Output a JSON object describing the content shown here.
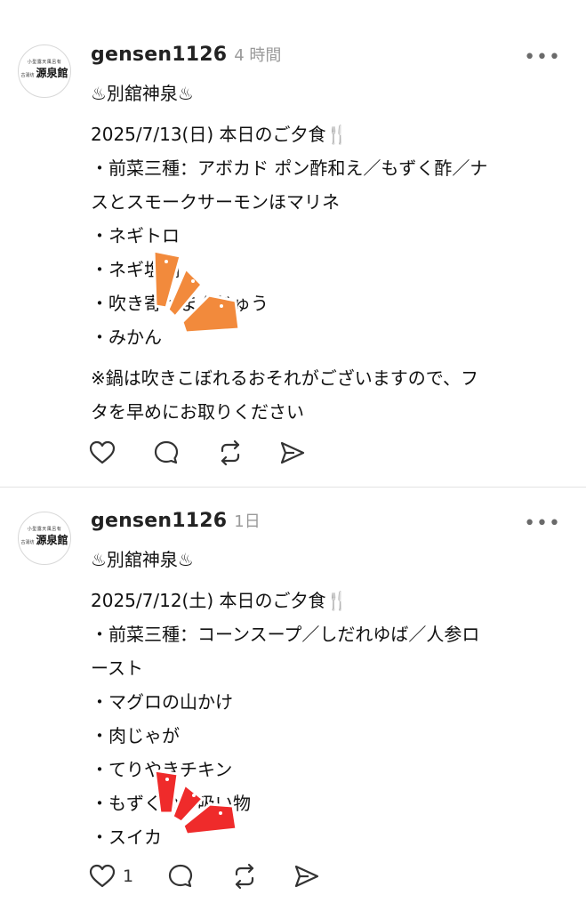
{
  "posts": [
    {
      "avatar_logo": {
        "small": "小型露天風呂有",
        "sub": "古湯坊",
        "name": "源泉館"
      },
      "username": "gensen1126",
      "time": "4 時間",
      "more": "•••",
      "lines": [
        "♨別舘神泉♨",
        "",
        "2025/7/13(日) 本日のご夕食🍴",
        "・前菜三種：アボカド ポン酢和え／もずく酢／ナ",
        "スとスモークサーモンほマリネ",
        "・ネギトロ",
        "・ネギ塩鍋",
        "・吹き寄せまんじゅう",
        "・みかん",
        "",
        "※鍋は吹きこぼれるおそれがございますので、フ",
        "タを早めにお取りください"
      ],
      "sticker_color": "#f28a3c",
      "likes": ""
    },
    {
      "avatar_logo": {
        "small": "小型露天風呂有",
        "sub": "古湯坊",
        "name": "源泉館"
      },
      "username": "gensen1126",
      "time": "1日",
      "more": "•••",
      "lines": [
        "♨別舘神泉♨",
        "",
        "2025/7/12(土) 本日のご夕食🍴",
        "・前菜三種：コーンスープ／しだれゆば／人参ロ",
        "ースト",
        "・マグロの山かけ",
        "・肉じゃが",
        "・てりやきチキン",
        "・もずくのお吸い物",
        "・スイカ"
      ],
      "sticker_color": "#ef2b2b",
      "likes": "1"
    }
  ],
  "icons": [
    "heart-icon",
    "comment-icon",
    "repost-icon",
    "share-icon",
    "more-icon"
  ]
}
